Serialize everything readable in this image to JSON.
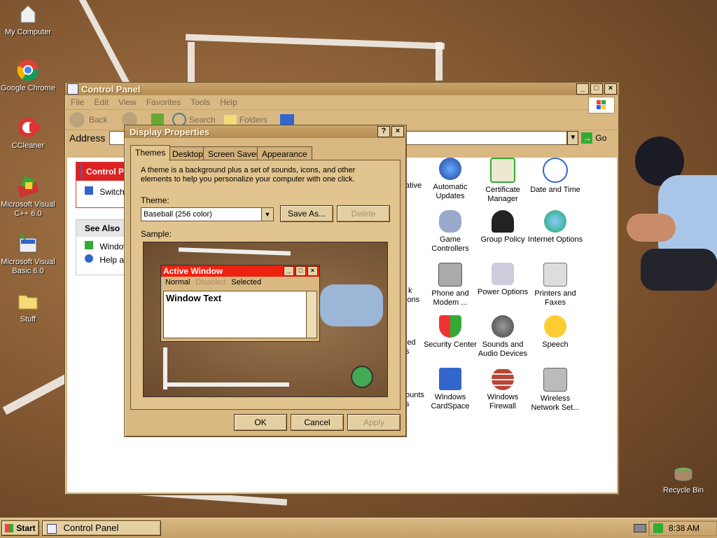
{
  "desktop": {
    "icons": [
      {
        "label": "My Computer"
      },
      {
        "label": "Google Chrome"
      },
      {
        "label": "CCleaner"
      },
      {
        "label": "Microsoft Visual C++ 6.0"
      },
      {
        "label": "Microsoft Visual Basic 6.0"
      },
      {
        "label": "Stuff"
      },
      {
        "label": "Recycle Bin"
      }
    ]
  },
  "control_panel": {
    "title": "Control Panel",
    "menu": [
      "File",
      "Edit",
      "View",
      "Favorites",
      "Tools",
      "Help"
    ],
    "toolbar": {
      "back": "Back",
      "search": "Search",
      "folders": "Folders"
    },
    "address_label": "Address",
    "go_label": "Go",
    "left_pane": {
      "header": "Control Panel",
      "switch_link": "Switch",
      "see_also_title": "See Also",
      "see_also_items": [
        "Window",
        "Help a"
      ]
    },
    "partial_items": [
      "ative",
      "k",
      "ions",
      "led",
      "s",
      "ounts",
      "s"
    ],
    "items": [
      {
        "label": "Automatic Updates",
        "icon": "globe-shield-icon"
      },
      {
        "label": "Certificate Manager",
        "icon": "certificate-icon"
      },
      {
        "label": "Date and Time",
        "icon": "clock-icon"
      },
      {
        "label": "Game Controllers",
        "icon": "gamepad-icon"
      },
      {
        "label": "Group Policy",
        "icon": "group-policy-icon"
      },
      {
        "label": "Internet Options",
        "icon": "globe-icon"
      },
      {
        "label": "Phone and Modem ...",
        "icon": "phone-icon"
      },
      {
        "label": "Power Options",
        "icon": "power-icon"
      },
      {
        "label": "Printers and Faxes",
        "icon": "printer-icon"
      },
      {
        "label": "Security Center",
        "icon": "shield-icon"
      },
      {
        "label": "Sounds and Audio Devices",
        "icon": "speaker-icon"
      },
      {
        "label": "Speech",
        "icon": "speech-icon"
      },
      {
        "label": "Windows CardSpace",
        "icon": "cardspace-icon"
      },
      {
        "label": "Windows Firewall",
        "icon": "firewall-icon"
      },
      {
        "label": "Wireless Network Set...",
        "icon": "wireless-icon"
      }
    ]
  },
  "display_properties": {
    "title": "Display Properties",
    "tabs": [
      "Themes",
      "Desktop",
      "Screen Saver",
      "Appearance"
    ],
    "description": "A theme is a background plus a set of sounds, icons, and other elements to help you personalize your computer with one click.",
    "theme_label": "Theme:",
    "theme_value": "Baseball (256 color)",
    "save_as": "Save As...",
    "delete": "Delete",
    "sample_label": "Sample:",
    "sample": {
      "active_window": "Active Window",
      "menu": [
        "Normal",
        "Disabled",
        "Selected"
      ],
      "window_text": "Window Text"
    },
    "buttons": {
      "ok": "OK",
      "cancel": "Cancel",
      "apply": "Apply"
    }
  },
  "taskbar": {
    "start": "Start",
    "task": "Control Panel",
    "clock": "8:38 AM"
  }
}
